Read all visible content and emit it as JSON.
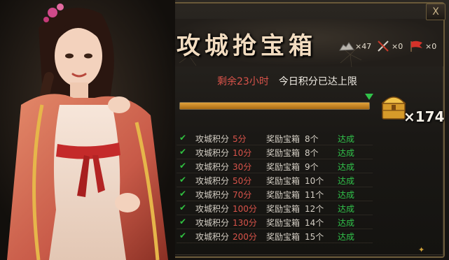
{
  "title": "攻城抢宝箱",
  "resources": [
    {
      "icon": "stone-pile-icon",
      "count": "×47"
    },
    {
      "icon": "crossed-swords-icon",
      "count": "×0"
    },
    {
      "icon": "red-flag-icon",
      "count": "×0"
    }
  ],
  "close_label": "X",
  "info": {
    "remaining": "剩余23小时",
    "limit_text": "今日积分已达上限"
  },
  "progress": {
    "fraction": 1.0
  },
  "chest": {
    "icon": "treasure-chest-icon",
    "count": "×174"
  },
  "rows": [
    {
      "label": "攻城积分",
      "points": "5分",
      "reward_label": "奖励宝箱",
      "reward_count": "8个",
      "status": "达成"
    },
    {
      "label": "攻城积分",
      "points": "10分",
      "reward_label": "奖励宝箱",
      "reward_count": "8个",
      "status": "达成"
    },
    {
      "label": "攻城积分",
      "points": "30分",
      "reward_label": "奖励宝箱",
      "reward_count": "9个",
      "status": "达成"
    },
    {
      "label": "攻城积分",
      "points": "50分",
      "reward_label": "奖励宝箱",
      "reward_count": "10个",
      "status": "达成"
    },
    {
      "label": "攻城积分",
      "points": "70分",
      "reward_label": "奖励宝箱",
      "reward_count": "11个",
      "status": "达成"
    },
    {
      "label": "攻城积分",
      "points": "100分",
      "reward_label": "奖励宝箱",
      "reward_count": "12个",
      "status": "达成"
    },
    {
      "label": "攻城积分",
      "points": "130分",
      "reward_label": "奖励宝箱",
      "reward_count": "14个",
      "status": "达成"
    },
    {
      "label": "攻城积分",
      "points": "200分",
      "reward_label": "奖励宝箱",
      "reward_count": "15个",
      "status": "达成"
    }
  ],
  "check_mark": "✔",
  "colors": {
    "accent_gold": "#d1a23a",
    "achieved_green": "#31c24a",
    "points_red": "#d9534a"
  }
}
